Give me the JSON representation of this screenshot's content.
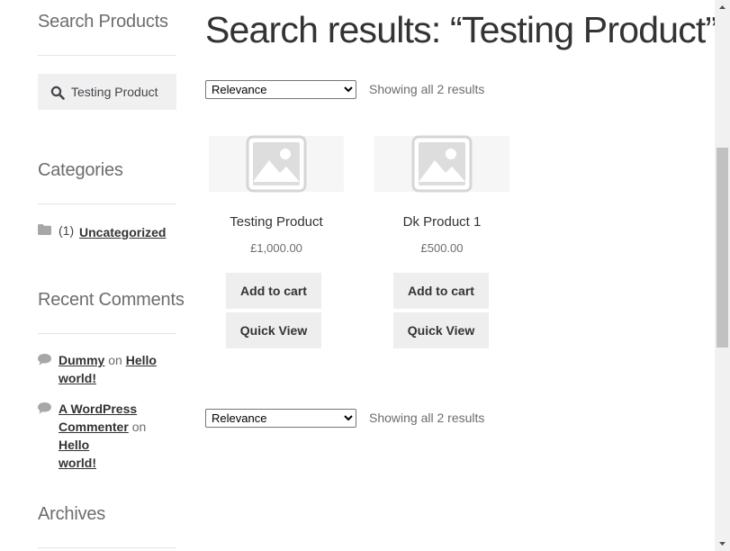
{
  "sidebar": {
    "search_title": "Search Products",
    "search_value": "Testing Product",
    "categories_title": "Categories",
    "category_link": "Uncategorized",
    "category_count": "(1)",
    "comments_title": "Recent Comments",
    "comments": [
      {
        "author": "Dummy",
        "on": "on",
        "post_line1": "Hello",
        "post_line2": "world!"
      },
      {
        "author_line1": "A WordPress",
        "author_line2": "Commenter",
        "on": "on",
        "post_line1": "Hello",
        "post_line2": "world!"
      }
    ],
    "archives_title": "Archives"
  },
  "main": {
    "title": "Search results: “Testing Product”",
    "orderby_selected": "Relevance",
    "result_count": "Showing all 2 results",
    "products": [
      {
        "name": "Testing Product",
        "price": "£1,000.00",
        "add_to_cart": "Add to cart",
        "quick_view": "Quick View"
      },
      {
        "name": "Dk Product 1",
        "price": "£500.00",
        "add_to_cart": "Add to cart",
        "quick_view": "Quick View"
      }
    ]
  },
  "colors": {
    "button_bg": "#eeeeee",
    "heading": "#333333",
    "muted": "#6d6d6d"
  },
  "icons": [
    "search-icon",
    "folder-icon",
    "comment-bubble-icon",
    "placeholder-image-icon"
  ]
}
